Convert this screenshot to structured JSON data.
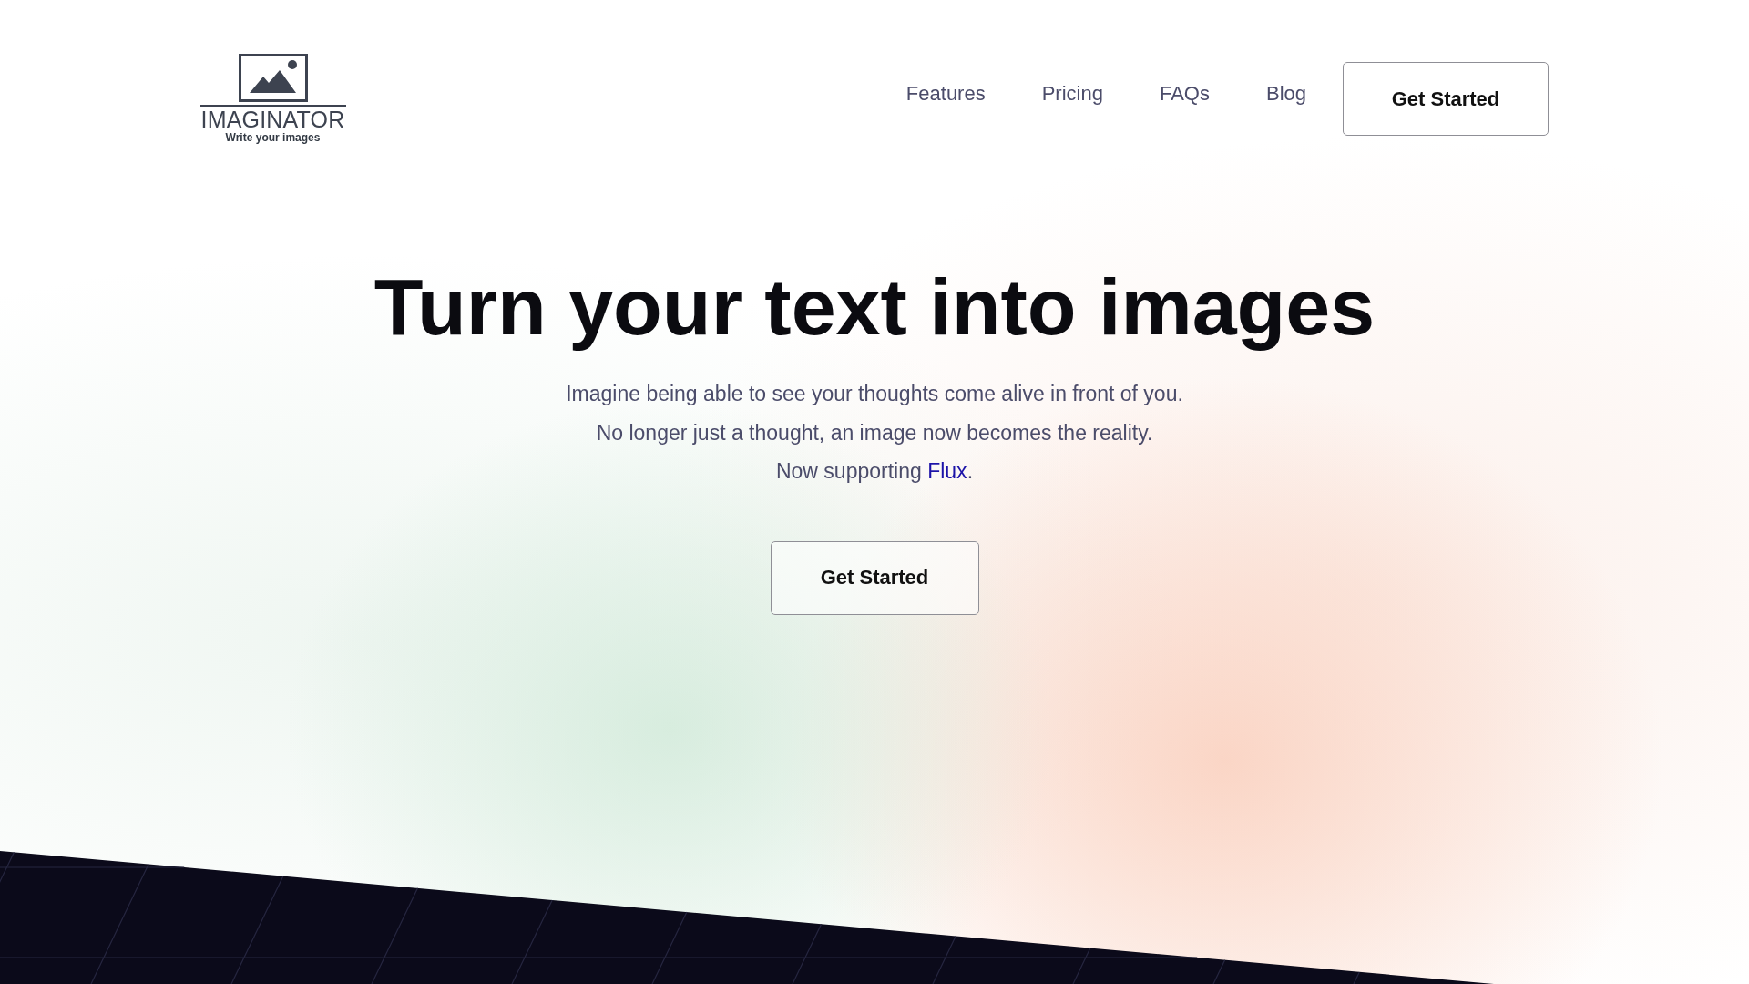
{
  "logo": {
    "name": "IMAGINATOR",
    "tagline": "Write your images"
  },
  "nav": {
    "links": [
      {
        "label": "Features"
      },
      {
        "label": "Pricing"
      },
      {
        "label": "FAQs"
      },
      {
        "label": "Blog"
      }
    ],
    "cta": "Get Started"
  },
  "hero": {
    "title": "Turn your text into images",
    "lines": [
      "Imagine being able to see your thoughts come alive in front of you.",
      "No longer just a thought, an image now becomes the reality."
    ],
    "support": {
      "text": "Now supporting",
      "link": "Flux",
      "end": "."
    },
    "cta": "Get Started"
  }
}
